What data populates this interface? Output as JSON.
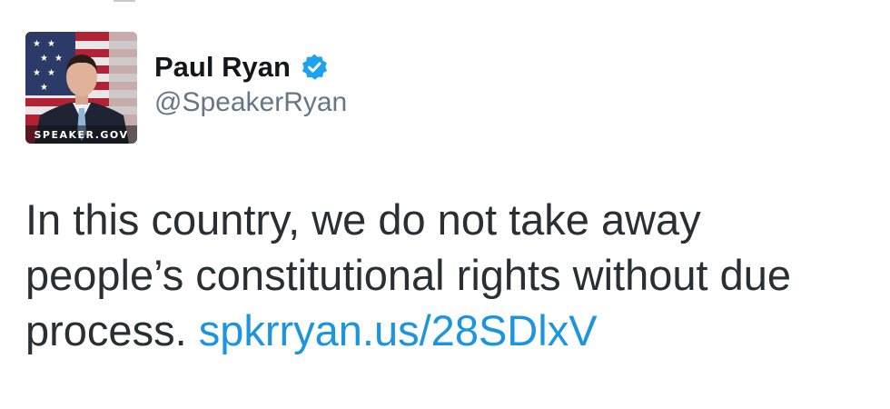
{
  "author": {
    "display_name": "Paul Ryan",
    "handle": "@SpeakerRyan",
    "verified": true,
    "avatar_caption": "SPEAKER.GOV"
  },
  "tweet": {
    "text": "In this country, we do not take away people’s constitutional rights without due process.",
    "link_text": "spkrryan.us/28SDlxV"
  },
  "colors": {
    "link": "#1b95e0",
    "verified_badge": "#1da1f2",
    "handle": "#657786",
    "text": "#292f33"
  },
  "icons": {
    "verified": "verified-badge-icon"
  }
}
